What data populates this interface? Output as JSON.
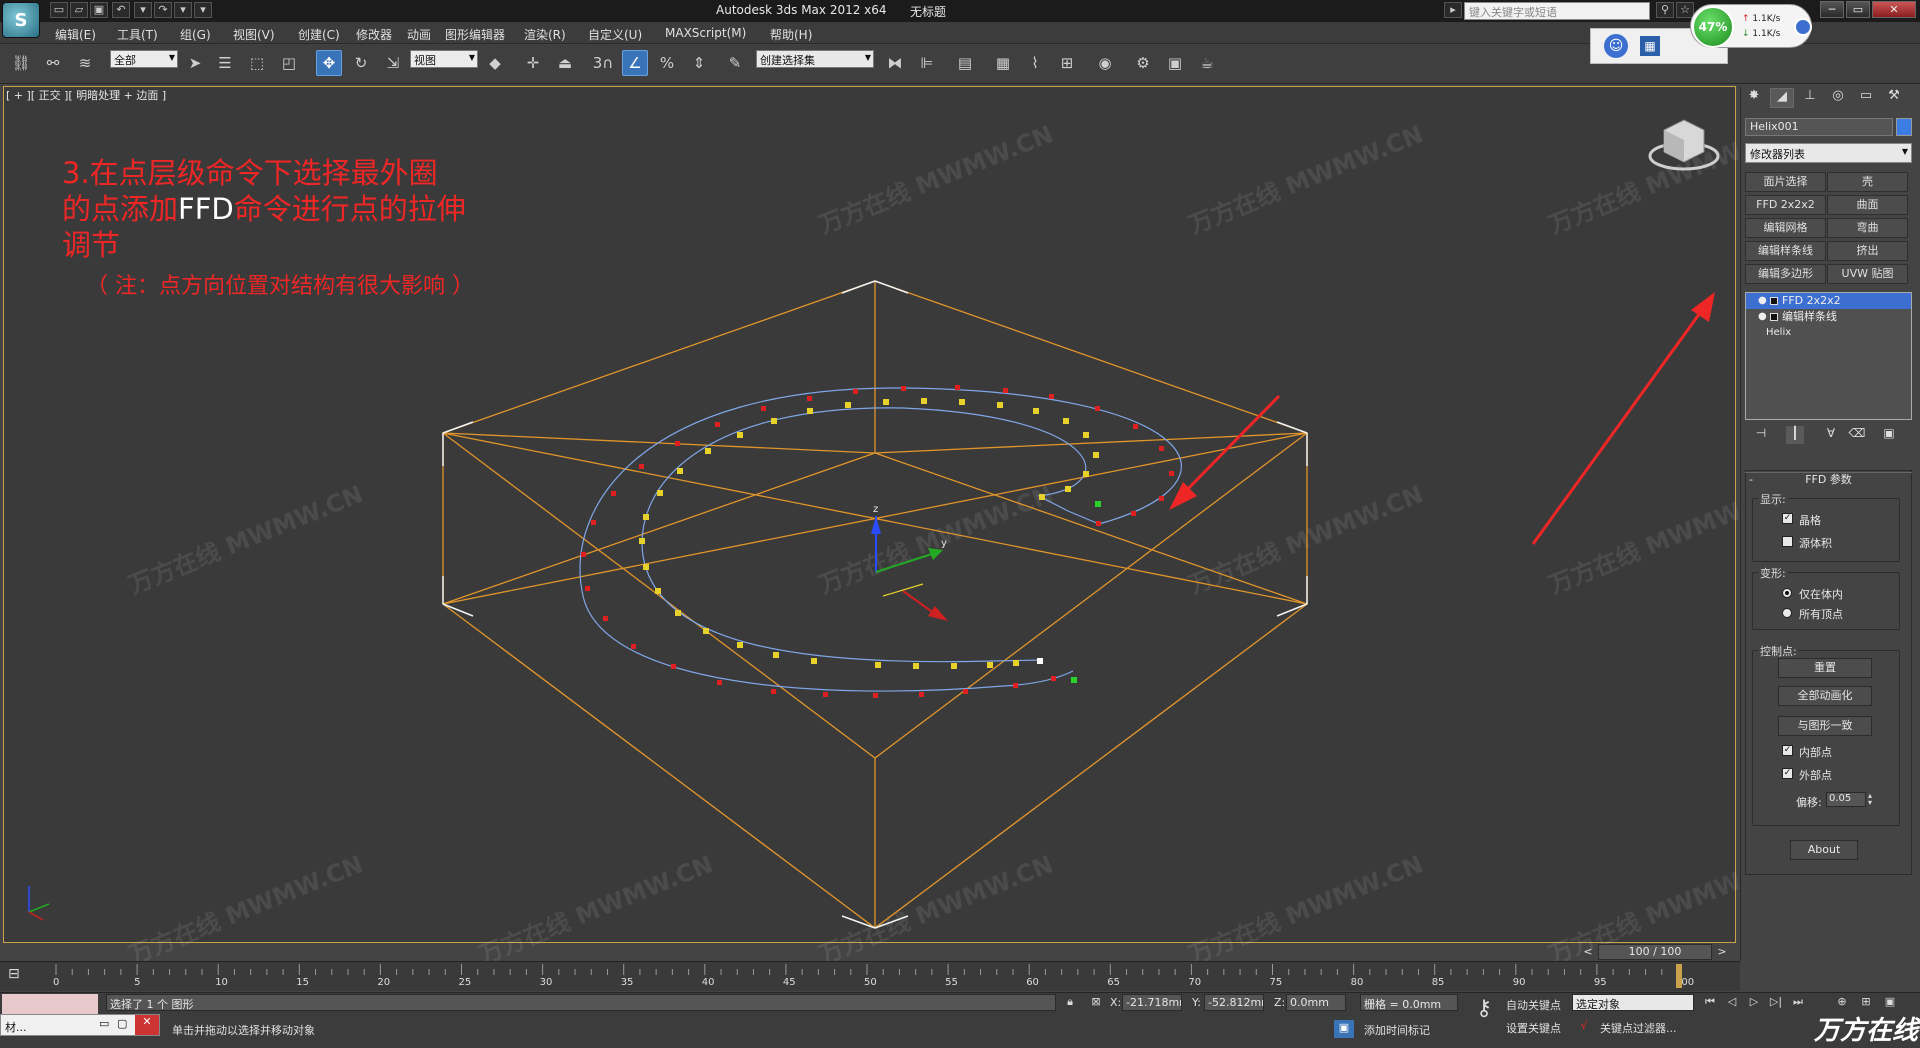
{
  "window": {
    "title": "Autodesk 3ds Max  2012 x64",
    "doc": "无标题",
    "search_placeholder": "键入关键字或短语",
    "app_logo": "S",
    "net_percent": "47%",
    "net_up": "1.1K/s",
    "net_down": "1.1K/s"
  },
  "menu": [
    "编辑(E)",
    "工具(T)",
    "组(G)",
    "视图(V)",
    "创建(C)",
    "修改器",
    "动画",
    "图形编辑器",
    "渲染(R)",
    "自定义(U)",
    "MAXScript(M)",
    "帮助(H)"
  ],
  "toolbar": {
    "filter": "全部",
    "ref_coord": "视图",
    "selection_set": "创建选择集",
    "snap_value": "3"
  },
  "viewport": {
    "label": "[ + ][ 正交 ][ 明暗处理 + 边面 ]",
    "note_line1": "3.在点层级命令下选择最外圈",
    "note_line2_a": "的点添加",
    "note_line2_b": "FFD",
    "note_line2_c": "命令进行点的拉伸",
    "note_line3": "调节",
    "note_sub": "（ 注：点方向位置对结构有很大影响 ）",
    "watermark": "MWMW.CN",
    "watermark_cn": "万方在线"
  },
  "command_panel": {
    "object_name": "Helix001",
    "modifier_list": "修改器列表",
    "quick_buttons": [
      "面片选择",
      "壳",
      "FFD 2x2x2",
      "曲面",
      "编辑网格",
      "弯曲",
      "编辑样条线",
      "挤出",
      "编辑多边形",
      "UVW 贴图"
    ],
    "stack": [
      {
        "label": "FFD 2x2x2",
        "selected": true
      },
      {
        "label": "编辑样条线",
        "selected": false
      },
      {
        "label": "Helix",
        "selected": false
      }
    ],
    "rollout_title": "FFD 参数",
    "display_group": "显示:",
    "display_options": [
      {
        "label": "晶格",
        "checked": true
      },
      {
        "label": "源体积",
        "checked": false
      }
    ],
    "deform_group": "变形:",
    "deform_options": [
      {
        "label": "仅在体内",
        "selected": true
      },
      {
        "label": "所有顶点",
        "selected": false
      }
    ],
    "control_group": "控制点:",
    "reset_btn": "重置",
    "animate_all_btn": "全部动画化",
    "conform_btn": "与图形一致",
    "inside_points": {
      "label": "内部点",
      "checked": true
    },
    "outside_points": {
      "label": "外部点",
      "checked": true
    },
    "offset_label": "偏移:",
    "offset_value": "0.05",
    "about_btn": "About"
  },
  "timeline": {
    "slider": "100 / 100",
    "ticks": [
      "0",
      "5",
      "10",
      "15",
      "20",
      "25",
      "30",
      "35",
      "40",
      "45",
      "50",
      "55",
      "60",
      "65",
      "70",
      "75",
      "80",
      "85",
      "90",
      "95",
      "100"
    ]
  },
  "status": {
    "selection_msg": "选择了 1 个 图形",
    "prompt": "单击并拖动以选择并移动对象",
    "x_label": "X:",
    "x_value": "-21.718mm",
    "y_label": "Y:",
    "y_value": "-52.812mm",
    "z_label": "Z:",
    "z_value": "0.0mm",
    "grid": "栅格 = 0.0mm",
    "add_time_tag": "添加时间标记",
    "auto_key": "自动关键点",
    "set_key": "设置关键点",
    "key_mode": "选定对象",
    "key_filters": "关键点过滤器...",
    "mini_window_title": "材...",
    "brand": "万方在线"
  },
  "colors": {
    "accent_blue": "#3a74b8",
    "lattice": "#e0952a",
    "spline": "#7fa6e6",
    "vertex_red": "#e02020",
    "vertex_yellow": "#e6d22a",
    "annotation_red": "#ee2626"
  }
}
